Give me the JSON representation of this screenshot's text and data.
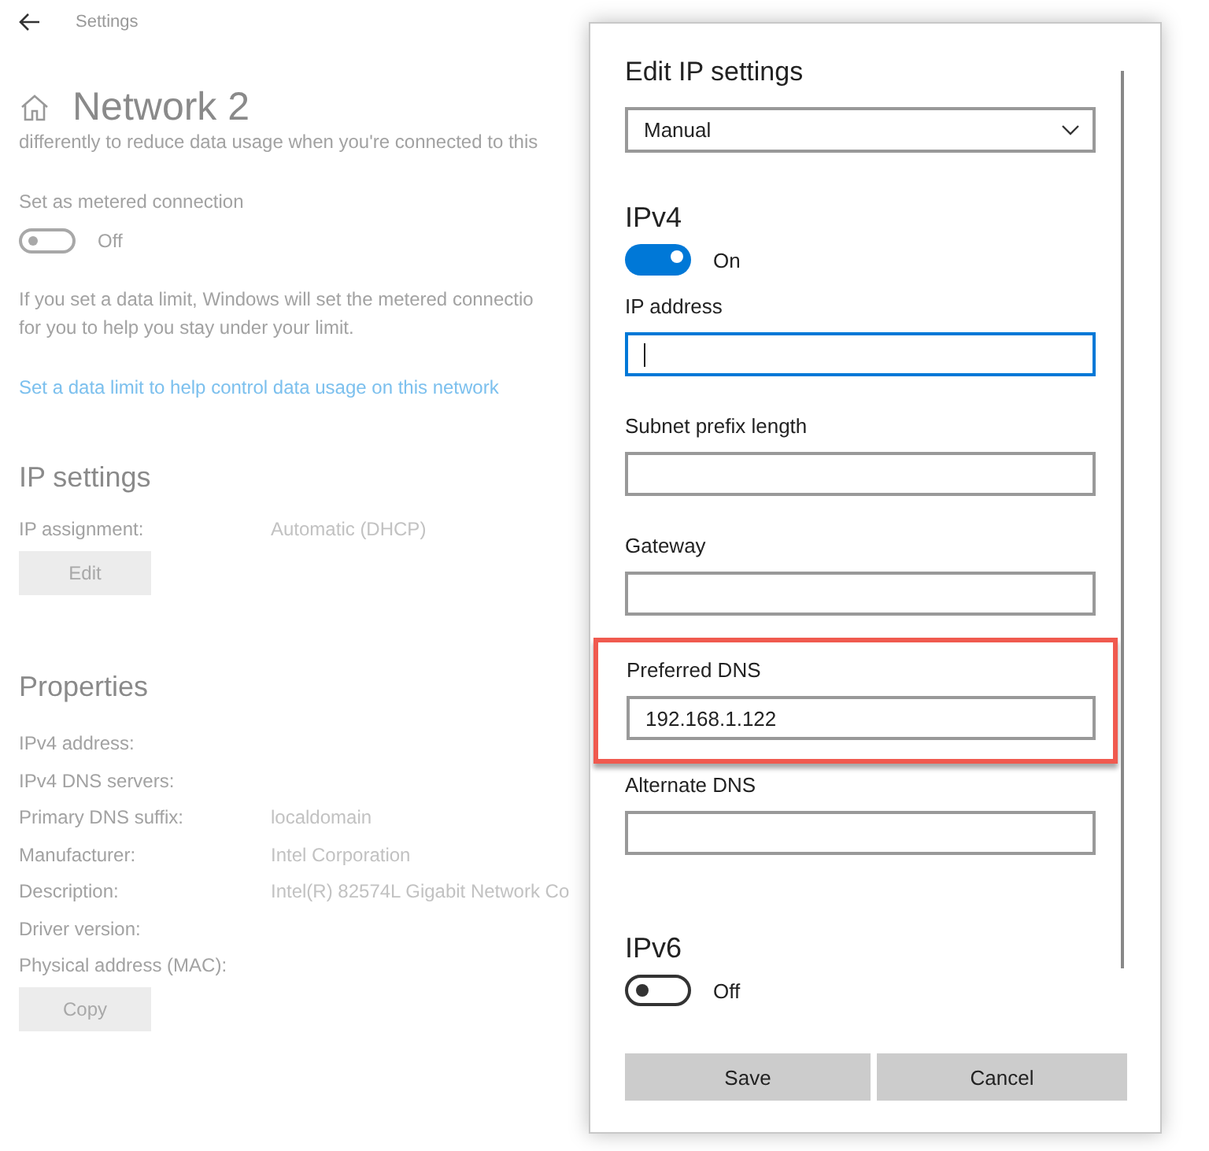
{
  "app_title": "Settings",
  "page": {
    "title": "Network 2",
    "intro": "differently to reduce data usage when you're connected to this",
    "metered": {
      "label": "Set as metered connection",
      "on": false,
      "state_label": "Off"
    },
    "note_lines": [
      "If you set a data limit, Windows will set the metered connectio",
      "for you to help you stay under your limit."
    ],
    "link": "Set a data limit to help control data usage on this network",
    "ip_settings": {
      "heading": "IP settings",
      "rows": [
        {
          "label": "IP assignment:",
          "value": "Automatic (DHCP)"
        }
      ],
      "button": "Edit"
    },
    "properties": {
      "heading": "Properties",
      "rows": [
        {
          "label": "IPv4 address:"
        },
        {
          "label": "IPv4 DNS servers:"
        },
        {
          "label": "Primary DNS suffix:",
          "value": "localdomain"
        },
        {
          "label": "Manufacturer:",
          "value": "Intel Corporation"
        },
        {
          "label": "Description:",
          "value": "Intel(R) 82574L Gigabit Network Co"
        },
        {
          "label": "Driver version:"
        },
        {
          "label": "Physical address (MAC):"
        }
      ],
      "button": "Copy"
    }
  },
  "dialog": {
    "title": "Edit IP settings",
    "dropdown": {
      "value": "Manual"
    },
    "ipv4": {
      "heading": "IPv4",
      "on": true,
      "state_label": "On"
    },
    "fields": [
      {
        "label": "IP address",
        "focused": true,
        "highlighted": false
      },
      {
        "label": "Subnet prefix length",
        "focused": false,
        "highlighted": false
      },
      {
        "label": "Gateway",
        "focused": false,
        "highlighted": false
      },
      {
        "label": "Preferred DNS",
        "value": "192.168.1.122",
        "focused": false,
        "highlighted": true
      },
      {
        "label": "Alternate DNS",
        "focused": false,
        "highlighted": false
      }
    ],
    "ipv6": {
      "heading": "IPv6",
      "on": false,
      "state_label": "Off"
    },
    "buttons": [
      "Save",
      "Cancel"
    ]
  }
}
